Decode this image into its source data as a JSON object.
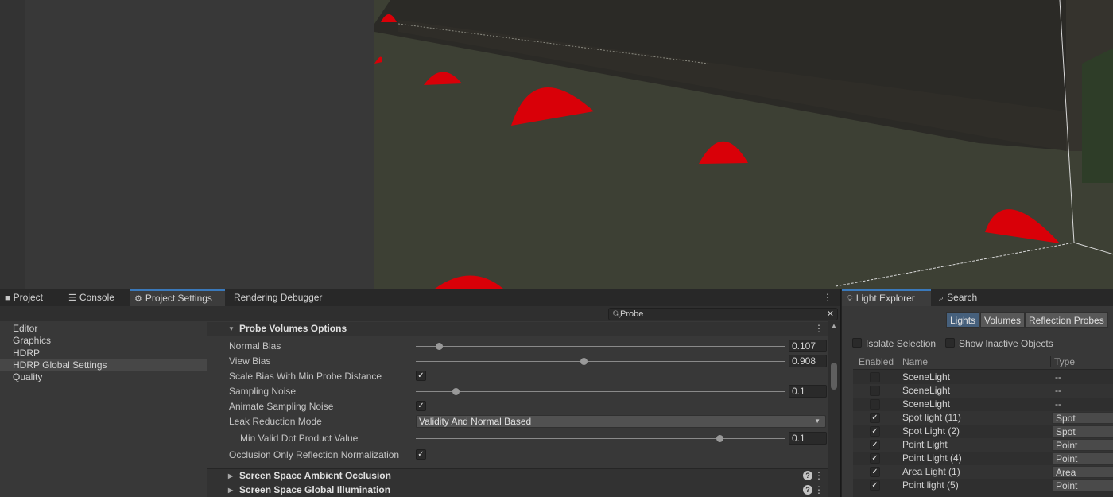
{
  "bottom_tabs": [
    {
      "label": "Project",
      "icon": "folder-icon"
    },
    {
      "label": "Console",
      "icon": "console-icon"
    },
    {
      "label": "Project Settings",
      "icon": "gear-icon"
    },
    {
      "label": "Rendering Debugger",
      "icon": ""
    }
  ],
  "search": {
    "value": "Probe"
  },
  "settings_list": [
    "Editor",
    "Graphics",
    "HDRP",
    "HDRP Global Settings",
    "Quality"
  ],
  "section": {
    "title": "Probe Volumes Options",
    "normal_bias": {
      "label": "Normal Bias",
      "value": "0.107",
      "slider_fraction": 0.062
    },
    "view_bias": {
      "label": "View Bias",
      "value": "0.908",
      "slider_fraction": 0.454
    },
    "scale_bias": {
      "label": "Scale Bias With Min Probe Distance",
      "checked": "✓"
    },
    "sampling_noise": {
      "label": "Sampling Noise",
      "value": "0.1",
      "slider_fraction": 0.108
    },
    "animate_noise": {
      "label": "Animate Sampling Noise",
      "checked": "✓"
    },
    "leak_mode": {
      "label": "Leak Reduction Mode",
      "value": "Validity And Normal Based"
    },
    "min_valid_dot": {
      "label": "Min Valid Dot Product Value",
      "value": "0.1",
      "slider_fraction": 0.823
    },
    "occlusion_norm": {
      "label": "Occlusion Only Reflection Normalization",
      "checked": "✓"
    }
  },
  "collapsed_sections": [
    "Screen Space Ambient Occlusion",
    "Screen Space Global Illumination"
  ],
  "light_explorer": {
    "tabs": [
      {
        "label": "Light Explorer",
        "icon": "bulb-icon"
      },
      {
        "label": "Search",
        "icon": "search-icon"
      }
    ],
    "segments": [
      "Lights",
      "Volumes",
      "Reflection Probes"
    ],
    "isolate_selection": "Isolate Selection",
    "show_inactive": "Show Inactive Objects",
    "columns": {
      "enabled": "Enabled",
      "name": "Name",
      "type": "Type"
    },
    "rows": [
      {
        "name": "SceneLight",
        "type": "--",
        "enabled": ""
      },
      {
        "name": "SceneLight",
        "type": "--",
        "enabled": ""
      },
      {
        "name": "SceneLight",
        "type": "--",
        "enabled": ""
      },
      {
        "name": "Spot light (11)",
        "type": "Spot",
        "enabled": "✓"
      },
      {
        "name": "Spot Light (2)",
        "type": "Spot",
        "enabled": "✓"
      },
      {
        "name": "Point Light",
        "type": "Point",
        "enabled": "✓"
      },
      {
        "name": "Point Light (4)",
        "type": "Point",
        "enabled": "✓"
      },
      {
        "name": "Area Light (1)",
        "type": "Area",
        "enabled": "✓"
      },
      {
        "name": "Point light (5)",
        "type": "Point",
        "enabled": "✓"
      }
    ]
  },
  "colors": {
    "accent": "#3a79bb",
    "scene_bg": "#2f302c",
    "probe_red": "#d90008"
  }
}
